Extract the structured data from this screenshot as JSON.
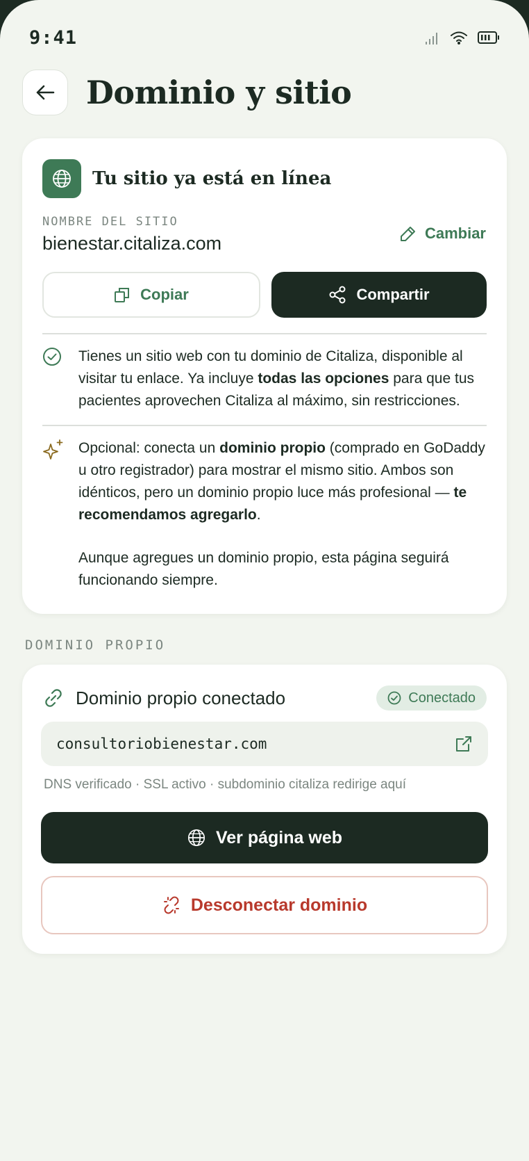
{
  "status": {
    "time": "9:41"
  },
  "header": {
    "title": "Dominio y sitio"
  },
  "site_card": {
    "title": "Tu sitio ya está en línea",
    "name_label": "NOMBRE DEL SITIO",
    "site_name": "bienestar.citaliza.com",
    "change_label": "Cambiar",
    "copy_label": "Copiar",
    "share_label": "Compartir",
    "info1": {
      "part1": "Tienes un sitio web con tu dominio de Citaliza, disponible al visitar tu enlace. Ya incluye ",
      "bold1": "todas las opciones",
      "part2": " para que tus pacientes aprovechen Citaliza al máximo, sin restricciones."
    },
    "info2": {
      "part1": "Opcional: conecta un ",
      "bold1": "dominio propio",
      "part2": " (comprado en GoDaddy u otro registrador) para mostrar el mismo sitio. Ambos son idénticos, pero un dominio propio luce más profesional — ",
      "bold2": "te recomendamos agregarlo",
      "part3": ".",
      "note": "Aunque agregues un dominio propio, esta página seguirá funcionando siempre."
    }
  },
  "custom_domain": {
    "section_label": "DOMINIO PROPIO",
    "title": "Dominio propio conectado",
    "badge": "Conectado",
    "domain": "consultoriobienestar.com",
    "dns_status": "DNS verificado · SSL activo · subdominio citaliza redirige aquí",
    "view_label": "Ver página web",
    "disconnect_label": "Desconectar dominio"
  },
  "colors": {
    "accent": "#3e7a56",
    "dark": "#1c2a22",
    "danger": "#b8392c",
    "background": "#f2f5ef"
  }
}
